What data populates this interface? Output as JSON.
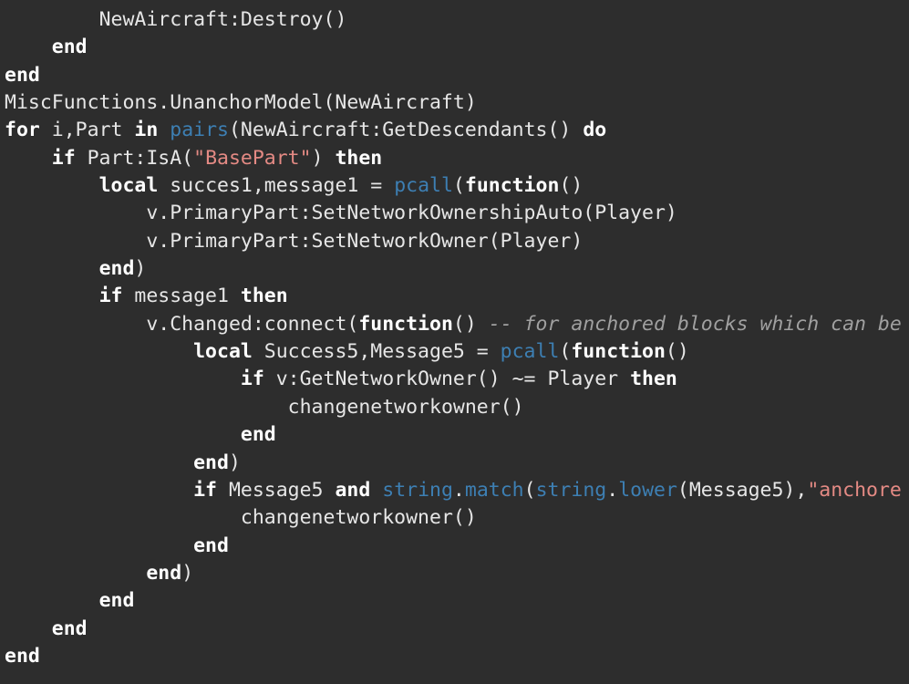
{
  "colors": {
    "background": "#2d2d2d",
    "text": "#e6e6e6",
    "keyword": "#ffffff",
    "builtin": "#3d7fb3",
    "string": "#e48a84",
    "comment": "#a0a0a0"
  },
  "code": {
    "lines": [
      [
        {
          "t": "ws",
          "v": "        "
        },
        {
          "t": "id",
          "v": "NewAircraft:Destroy()"
        }
      ],
      [
        {
          "t": "ws",
          "v": "    "
        },
        {
          "t": "kw",
          "v": "end"
        }
      ],
      [
        {
          "t": "kw",
          "v": "end"
        }
      ],
      [
        {
          "t": "id",
          "v": "MiscFunctions.UnanchorModel(NewAircraft)"
        }
      ],
      [
        {
          "t": "kw",
          "v": "for"
        },
        {
          "t": "id",
          "v": " i,Part "
        },
        {
          "t": "kw",
          "v": "in"
        },
        {
          "t": "id",
          "v": " "
        },
        {
          "t": "builtin",
          "v": "pairs"
        },
        {
          "t": "id",
          "v": "(NewAircraft:GetDescendants() "
        },
        {
          "t": "kw",
          "v": "do"
        }
      ],
      [
        {
          "t": "ws",
          "v": "    "
        },
        {
          "t": "kw",
          "v": "if"
        },
        {
          "t": "id",
          "v": " Part:IsA("
        },
        {
          "t": "str",
          "v": "\"BasePart\""
        },
        {
          "t": "id",
          "v": ") "
        },
        {
          "t": "kw",
          "v": "then"
        }
      ],
      [
        {
          "t": "ws",
          "v": "        "
        },
        {
          "t": "kw",
          "v": "local"
        },
        {
          "t": "id",
          "v": " succes1,message1 = "
        },
        {
          "t": "builtin",
          "v": "pcall"
        },
        {
          "t": "id",
          "v": "("
        },
        {
          "t": "kw",
          "v": "function"
        },
        {
          "t": "id",
          "v": "()"
        }
      ],
      [
        {
          "t": "ws",
          "v": "            "
        },
        {
          "t": "id",
          "v": "v.PrimaryPart:SetNetworkOwnershipAuto(Player)"
        }
      ],
      [
        {
          "t": "ws",
          "v": "            "
        },
        {
          "t": "id",
          "v": "v.PrimaryPart:SetNetworkOwner(Player)"
        }
      ],
      [
        {
          "t": "ws",
          "v": "        "
        },
        {
          "t": "kw",
          "v": "end"
        },
        {
          "t": "id",
          "v": ")"
        }
      ],
      [
        {
          "t": "ws",
          "v": "        "
        },
        {
          "t": "kw",
          "v": "if"
        },
        {
          "t": "id",
          "v": " message1 "
        },
        {
          "t": "kw",
          "v": "then"
        }
      ],
      [
        {
          "t": "ws",
          "v": "            "
        },
        {
          "t": "id",
          "v": "v.Changed:connect("
        },
        {
          "t": "kw",
          "v": "function"
        },
        {
          "t": "id",
          "v": "() "
        },
        {
          "t": "comment",
          "v": "-- for anchored blocks which can be"
        }
      ],
      [
        {
          "t": "ws",
          "v": "                "
        },
        {
          "t": "kw",
          "v": "local"
        },
        {
          "t": "id",
          "v": " Success5,Message5 = "
        },
        {
          "t": "builtin",
          "v": "pcall"
        },
        {
          "t": "id",
          "v": "("
        },
        {
          "t": "kw",
          "v": "function"
        },
        {
          "t": "id",
          "v": "()"
        }
      ],
      [
        {
          "t": "ws",
          "v": "                    "
        },
        {
          "t": "kw",
          "v": "if"
        },
        {
          "t": "id",
          "v": " v:GetNetworkOwner() ~= Player "
        },
        {
          "t": "kw",
          "v": "then"
        }
      ],
      [
        {
          "t": "ws",
          "v": "                        "
        },
        {
          "t": "id",
          "v": "changenetworkowner()"
        }
      ],
      [
        {
          "t": "ws",
          "v": "                    "
        },
        {
          "t": "kw",
          "v": "end"
        }
      ],
      [
        {
          "t": "ws",
          "v": "                "
        },
        {
          "t": "kw",
          "v": "end"
        },
        {
          "t": "id",
          "v": ")"
        }
      ],
      [
        {
          "t": "ws",
          "v": "                "
        },
        {
          "t": "kw",
          "v": "if"
        },
        {
          "t": "id",
          "v": " Message5 "
        },
        {
          "t": "kw",
          "v": "and"
        },
        {
          "t": "id",
          "v": " "
        },
        {
          "t": "builtin",
          "v": "string"
        },
        {
          "t": "id",
          "v": "."
        },
        {
          "t": "builtin",
          "v": "match"
        },
        {
          "t": "id",
          "v": "("
        },
        {
          "t": "builtin",
          "v": "string"
        },
        {
          "t": "id",
          "v": "."
        },
        {
          "t": "builtin",
          "v": "lower"
        },
        {
          "t": "id",
          "v": "(Message5),"
        },
        {
          "t": "str",
          "v": "\"anchore"
        }
      ],
      [
        {
          "t": "ws",
          "v": "                    "
        },
        {
          "t": "id",
          "v": "changenetworkowner()"
        }
      ],
      [
        {
          "t": "ws",
          "v": "                "
        },
        {
          "t": "kw",
          "v": "end"
        }
      ],
      [
        {
          "t": "ws",
          "v": "            "
        },
        {
          "t": "kw",
          "v": "end"
        },
        {
          "t": "id",
          "v": ")"
        }
      ],
      [
        {
          "t": "ws",
          "v": "        "
        },
        {
          "t": "kw",
          "v": "end"
        }
      ],
      [
        {
          "t": "ws",
          "v": "    "
        },
        {
          "t": "kw",
          "v": "end"
        }
      ],
      [
        {
          "t": "kw",
          "v": "end"
        }
      ]
    ]
  }
}
